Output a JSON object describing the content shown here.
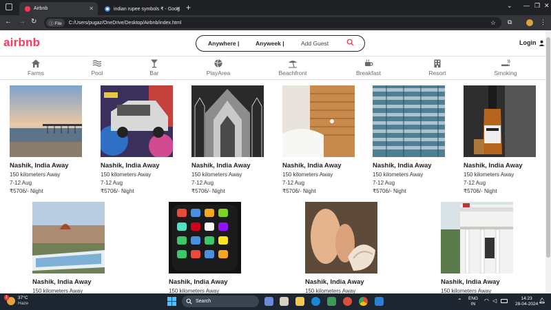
{
  "browser": {
    "tabs": [
      {
        "title": "Airbnb",
        "active": true
      },
      {
        "title": "indian rupee symbols ₹ - Goog",
        "active": false
      }
    ],
    "address": {
      "chip": "File",
      "url": "C:/Users/pugaz/OneDrive/Desktop/Airbnb/index.html"
    }
  },
  "header": {
    "logo": "airbnb",
    "search": {
      "anywhere": "Anywhere |",
      "anyweek": "Anyweek |",
      "guest": "Add Guest"
    },
    "login": "Login"
  },
  "categories": [
    {
      "label": "Farms",
      "icon": "home-icon"
    },
    {
      "label": "Pool",
      "icon": "water-icon"
    },
    {
      "label": "Bar",
      "icon": "bar-icon"
    },
    {
      "label": "PlayArea",
      "icon": "ball-icon"
    },
    {
      "label": "Beachfront",
      "icon": "umbrella-icon"
    },
    {
      "label": "Breakfast",
      "icon": "mug-icon"
    },
    {
      "label": "Resort",
      "icon": "building-icon"
    },
    {
      "label": "Smoking",
      "icon": "smoking-icon"
    }
  ],
  "listings": [
    {
      "title": "Nashik, India Away",
      "distance": "150 kilometers Away",
      "dates": "7-12 Aug",
      "price": "₹5706/- Night",
      "photo": "pier-sunset"
    },
    {
      "title": "Nashik, India Away",
      "distance": "150 kilometers Away",
      "dates": "7-12 Aug",
      "price": "₹5706/- Night",
      "photo": "graffiti-car"
    },
    {
      "title": "Nashik, India Away",
      "distance": "150 kilometers Away",
      "dates": "7-12 Aug",
      "price": "₹5706/- Night",
      "photo": "gothic-cathedral"
    },
    {
      "title": "Nashik, India Away",
      "distance": "150 kilometers Away",
      "dates": "7-12 Aug",
      "price": "₹5706/- Night",
      "photo": "bedroom-wood"
    },
    {
      "title": "Nashik, India Away",
      "distance": "150 kilometers Away",
      "dates": "7-12 Aug",
      "price": "₹5706/- Night",
      "photo": "glass-building"
    },
    {
      "title": "Nashik, India Away",
      "distance": "150 kilometers Away",
      "dates": "7-12 Aug",
      "price": "₹5706/- Night",
      "photo": "whiskey-bottle"
    },
    {
      "title": "Nashik, India Away",
      "distance": "150 kilometers Away",
      "dates": "",
      "price": "",
      "photo": "florence-painting"
    },
    {
      "title": "Nashik, India Away",
      "distance": "150 kilometers Away",
      "dates": "",
      "price": "",
      "photo": "smartphone"
    },
    {
      "title": "Nashik, India Away",
      "distance": "150 kilometers Away",
      "dates": "",
      "price": "",
      "photo": "baby-feet-shell"
    },
    {
      "title": "Nashik, India Away",
      "distance": "150 kilometers Away",
      "dates": "",
      "price": "",
      "photo": "white-porch"
    }
  ],
  "taskbar": {
    "weather": {
      "temp": "37°C",
      "condition": "Haze",
      "badge": "1"
    },
    "search_placeholder": "Search",
    "lang": {
      "top": "ENG",
      "bottom": "IN"
    },
    "clock": {
      "time": "14:23",
      "date": "28-04-2024"
    }
  },
  "colors": {
    "brand": "#ff385c",
    "chrome_dark": "#202124",
    "taskbar": "#1c2530"
  }
}
